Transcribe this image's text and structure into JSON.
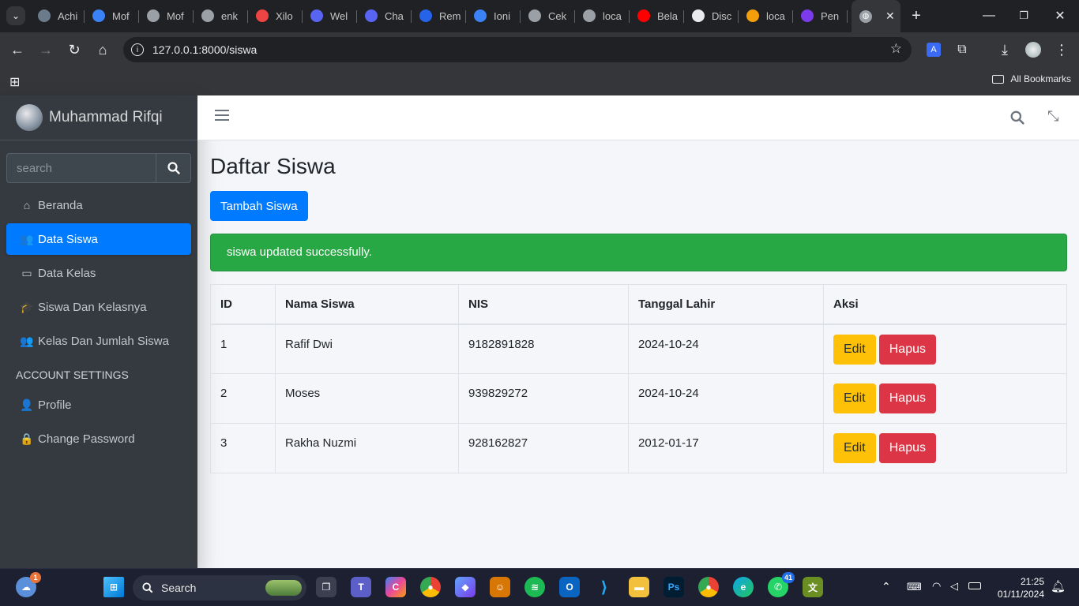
{
  "browser": {
    "tabs": [
      {
        "label": "Achi",
        "icon": "app-icon",
        "color": "#6b7b8c"
      },
      {
        "label": "Mof",
        "icon": "flutter-icon",
        "color": "#3b82f6"
      },
      {
        "label": "Mof",
        "icon": "a-icon",
        "color": "#9aa0a6"
      },
      {
        "label": "enk",
        "icon": "a-icon",
        "color": "#9aa0a6"
      },
      {
        "label": "Xilo",
        "icon": "xilo-icon",
        "color": "#ef4444"
      },
      {
        "label": "Wel",
        "icon": "discord-icon",
        "color": "#5865f2"
      },
      {
        "label": "Cha",
        "icon": "discord-icon",
        "color": "#5865f2"
      },
      {
        "label": "Rem",
        "icon": "rem-icon",
        "color": "#2563eb"
      },
      {
        "label": "Ioni",
        "icon": "ionic-icon",
        "color": "#3b82f6"
      },
      {
        "label": "Cek",
        "icon": "openai-icon",
        "color": "#9aa0a6"
      },
      {
        "label": "loca",
        "icon": "laravel-icon",
        "color": "#9aa0a6"
      },
      {
        "label": "Bela",
        "icon": "youtube-icon",
        "color": "#ff0000"
      },
      {
        "label": "Disc",
        "icon": "github-icon",
        "color": "#e8eaed"
      },
      {
        "label": "loca",
        "icon": "laravel-icon",
        "color": "#f59e0b"
      },
      {
        "label": "Pen",
        "icon": "list-icon",
        "color": "#7c3aed"
      }
    ],
    "url": "127.0.0.1:8000/siswa",
    "all_bookmarks": "All Bookmarks"
  },
  "sidebar": {
    "user_name": "Muhammad Rifqi",
    "search_placeholder": "search",
    "items": [
      {
        "label": "Beranda",
        "icon": "home-icon"
      },
      {
        "label": "Data Siswa",
        "icon": "users-icon",
        "active": true
      },
      {
        "label": "Data Kelas",
        "icon": "chalkboard-icon"
      },
      {
        "label": "Siswa Dan Kelasnya",
        "icon": "student-icon"
      },
      {
        "label": "Kelas Dan Jumlah Siswa",
        "icon": "users-icon"
      }
    ],
    "account_header": "ACCOUNT SETTINGS",
    "account_items": [
      {
        "label": "Profile",
        "icon": "user-icon"
      },
      {
        "label": "Change Password",
        "icon": "lock-icon"
      }
    ]
  },
  "main": {
    "title": "Daftar Siswa",
    "add_button": "Tambah Siswa",
    "alert": "siswa updated successfully.",
    "table": {
      "headers": [
        "ID",
        "Nama Siswa",
        "NIS",
        "Tanggal Lahir",
        "Aksi"
      ],
      "rows": [
        {
          "id": "1",
          "name": "Rafif Dwi",
          "nis": "9182891828",
          "dob": "2024-10-24"
        },
        {
          "id": "2",
          "name": "Moses",
          "nis": "939829272",
          "dob": "2024-10-24"
        },
        {
          "id": "3",
          "name": "Rakha Nuzmi",
          "nis": "928162827",
          "dob": "2012-01-17"
        }
      ],
      "edit_label": "Edit",
      "delete_label": "Hapus"
    }
  },
  "taskbar": {
    "search_label": "Search",
    "weather_badge": "1",
    "whatsapp_badge": "41",
    "time": "21:25",
    "date": "01/11/2024"
  }
}
